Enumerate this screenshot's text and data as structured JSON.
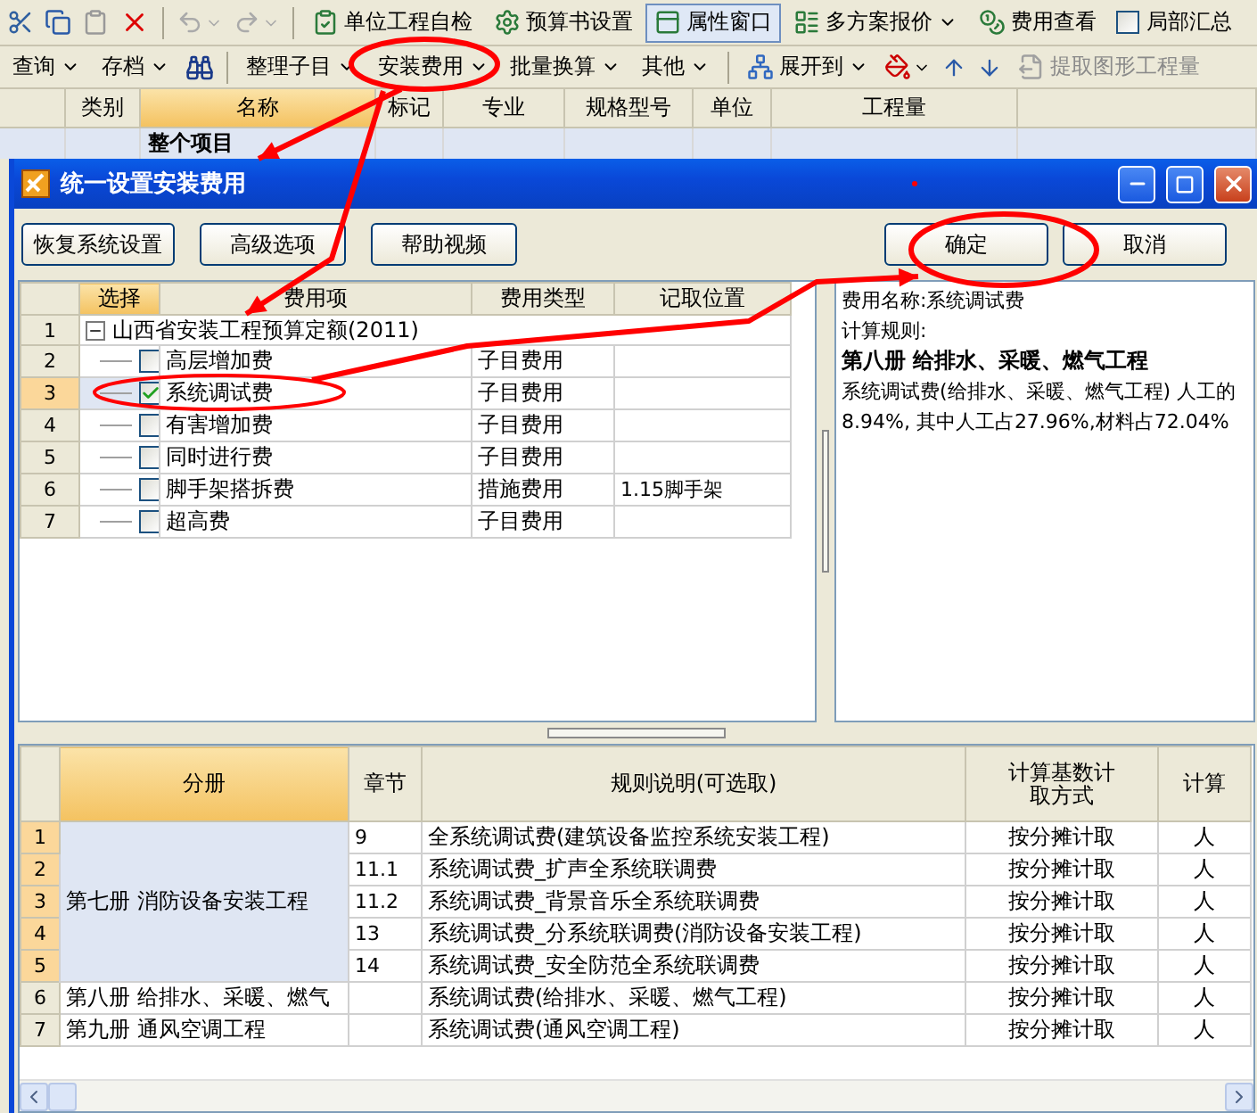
{
  "toolbar_top": {
    "buttons": [
      {
        "label": "单位工程自检",
        "pressed": false,
        "dropdown": false
      },
      {
        "label": "预算书设置",
        "pressed": false,
        "dropdown": false
      },
      {
        "label": "属性窗口",
        "pressed": true,
        "dropdown": false
      },
      {
        "label": "多方案报价",
        "pressed": false,
        "dropdown": true
      },
      {
        "label": "费用查看",
        "pressed": false,
        "dropdown": false
      }
    ],
    "checkbox": {
      "label": "局部汇总",
      "checked": false
    }
  },
  "toolbar_second": {
    "buttons": [
      {
        "label": "查询",
        "dropdown": true,
        "disabled": false
      },
      {
        "label": "存档",
        "dropdown": true,
        "disabled": false
      },
      {
        "label": "整理子目",
        "dropdown": true,
        "disabled": false
      },
      {
        "label": "安装费用",
        "dropdown": true,
        "disabled": false
      },
      {
        "label": "批量换算",
        "dropdown": true,
        "disabled": false
      },
      {
        "label": "其他",
        "dropdown": true,
        "disabled": false
      },
      {
        "label": "展开到",
        "dropdown": true,
        "disabled": false
      },
      {
        "label": "提取图形工程量",
        "dropdown": false,
        "disabled": true
      }
    ]
  },
  "main_table": {
    "columns": [
      {
        "label": "类别",
        "selected": false
      },
      {
        "label": "名称",
        "selected": true
      },
      {
        "label": "标记",
        "selected": false
      },
      {
        "label": "专业",
        "selected": false
      },
      {
        "label": "规格型号",
        "selected": false
      },
      {
        "label": "单位",
        "selected": false
      },
      {
        "label": "工程量",
        "selected": false
      }
    ],
    "rows": [
      {
        "name": "整个项目"
      }
    ]
  },
  "dialog": {
    "title": "统一设置安装费用",
    "buttons": [
      "恢复系统设置",
      "高级选项",
      "帮助视频"
    ],
    "confirm_buttons": [
      "确定",
      "取消"
    ],
    "fee_grid": {
      "columns": [
        "选择",
        "费用项",
        "费用类型",
        "记取位置"
      ],
      "root": {
        "no": "1",
        "label": "山西省安装工程预算定额(2011)",
        "expanded": true,
        "selected": false,
        "children": [
          {
            "no": "2",
            "name": "高层增加费",
            "type": "子目费用",
            "checked": false,
            "selected": false
          },
          {
            "no": "3",
            "name": "系统调试费",
            "type": "子目费用",
            "checked": true,
            "selected": true
          },
          {
            "no": "4",
            "name": "有害增加费",
            "type": "子目费用",
            "checked": false,
            "selected": false
          },
          {
            "no": "5",
            "name": "同时进行费",
            "type": "子目费用",
            "checked": false,
            "selected": false
          },
          {
            "no": "6",
            "name": "脚手架搭拆费",
            "type": "措施费用",
            "position": "1.15脚手架",
            "checked": false,
            "selected": false
          },
          {
            "no": "7",
            "name": "超高费",
            "type": "子目费用",
            "checked": false,
            "selected": false
          }
        ]
      }
    },
    "detail": {
      "name_line": "费用名称:系统调试费",
      "rule_label": "计算规则:",
      "heading": "第八册  给排水、采暖、燃气工程",
      "text": "系统调试费(给排水、采暖、燃气工程) 人工的8.94%, 其中人工占27.96%,材料占72.04%"
    },
    "rule_grid": {
      "columns": [
        "分册",
        "章节",
        "规则说明(可选取)",
        "计算基数计取方式",
        "计算"
      ],
      "groups": [
        {
          "volume": "第七册 消防设备安装工程",
          "selected": true,
          "rows": [
            {
              "no": "1",
              "chapter": "9",
              "rule": "全系统调试费(建筑设备监控系统安装工程)",
              "method": "按分摊计取",
              "column_5": "人"
            },
            {
              "no": "2",
              "chapter": "11.1",
              "rule": "系统调试费_扩声全系统联调费",
              "method": "按分摊计取",
              "column_5": "人"
            },
            {
              "no": "3",
              "chapter": "11.2",
              "rule": "系统调试费_背景音乐全系统联调费",
              "method": "按分摊计取",
              "column_5": "人"
            },
            {
              "no": "4",
              "chapter": "13",
              "rule": "系统调试费_分系统联调费(消防设备安装工程)",
              "method": "按分摊计取",
              "column_5": "人"
            },
            {
              "no": "5",
              "chapter": "14",
              "rule": "系统调试费_安全防范全系统联调费",
              "method": "按分摊计取",
              "column_5": "人"
            }
          ]
        },
        {
          "volume": "第八册 给排水、采暖、燃气",
          "selected": false,
          "rows": [
            {
              "no": "6",
              "rule": "系统调试费(给排水、采暖、燃气工程)",
              "method": "按分摊计取",
              "column_5": "人"
            }
          ]
        },
        {
          "volume": "第九册 通风空调工程",
          "selected": false,
          "rows": [
            {
              "no": "7",
              "rule": "系统调试费(通风空调工程)",
              "method": "按分摊计取",
              "column_5": "人"
            }
          ]
        }
      ]
    }
  }
}
